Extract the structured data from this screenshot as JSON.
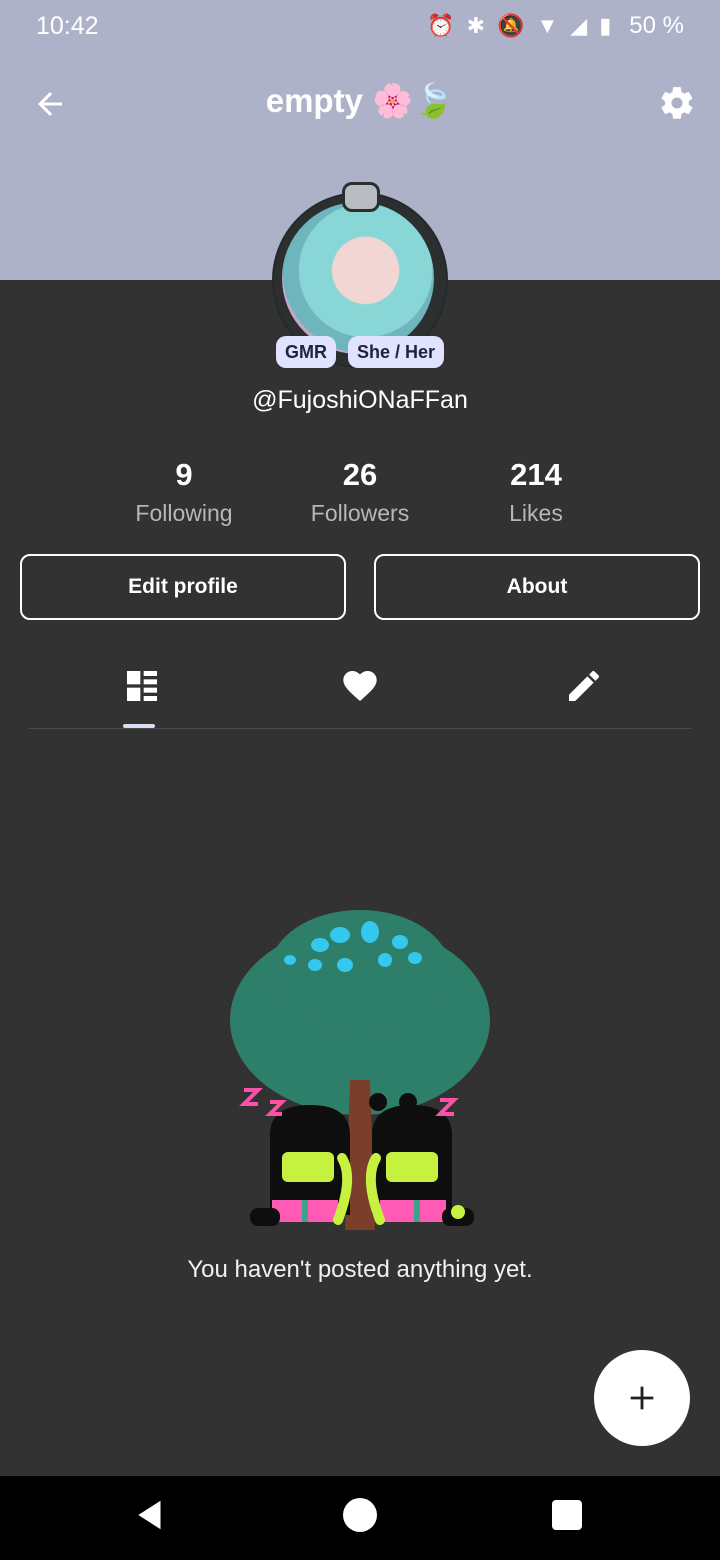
{
  "status_bar": {
    "time": "10:42",
    "battery": "50 %"
  },
  "header": {
    "title": "empty 🌸🍃"
  },
  "profile": {
    "badges": [
      "GMR",
      "She / Her"
    ],
    "username": "@FujoshiONaFFan"
  },
  "stats": [
    {
      "value": "9",
      "label": "Following"
    },
    {
      "value": "26",
      "label": "Followers"
    },
    {
      "value": "214",
      "label": "Likes"
    }
  ],
  "actions": {
    "edit_profile": "Edit profile",
    "about": "About"
  },
  "tabs": [
    {
      "icon": "grid-icon",
      "selected": true
    },
    {
      "icon": "heart-icon",
      "selected": false
    },
    {
      "icon": "pencil-icon",
      "selected": false
    }
  ],
  "empty_state": {
    "message": "You haven't posted anything yet."
  },
  "colors": {
    "header_bg": "#aeb2c9",
    "page_bg": "#323232",
    "badge_bg": "#dfe3ff"
  }
}
